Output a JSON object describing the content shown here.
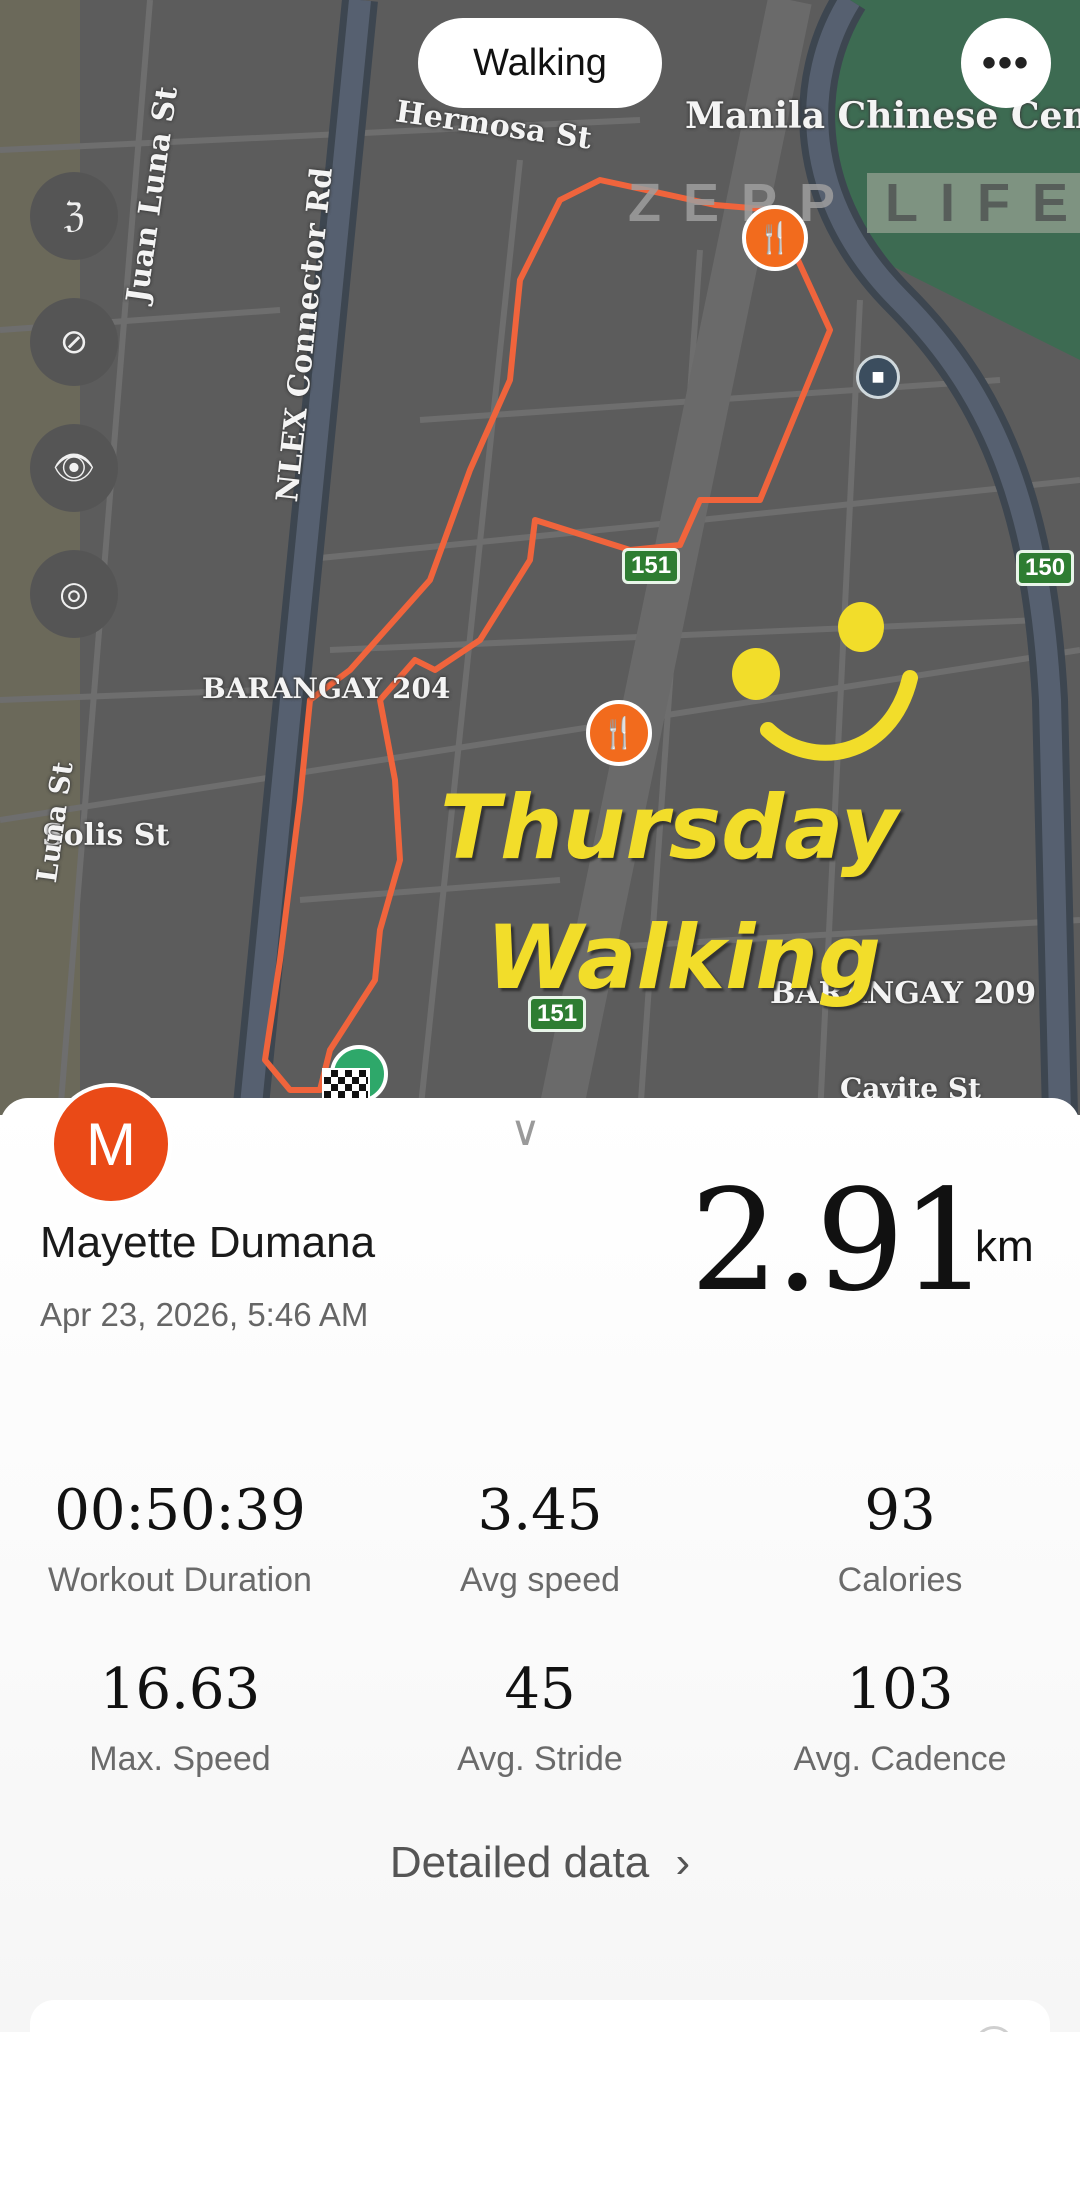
{
  "map": {
    "activity_label": "Walking",
    "more_icon": "more-dots-icon",
    "watermark_left": "ZEPP",
    "watermark_right": "LIFE",
    "streets": [
      "Juan Luna St",
      "NLEX Connector Rd",
      "Hermosa St",
      "Manila Chinese Cem",
      "BARANGAY 204",
      "Solis St",
      "BARANGAY 209",
      "Cavite St",
      "Luna St"
    ],
    "route_shields": [
      "151",
      "151",
      "150"
    ],
    "overlay_line1": "Thursday",
    "overlay_line2": "Walking",
    "controls": [
      "km-unit-icon",
      "no-network-icon",
      "eye-icon",
      "locate-icon"
    ],
    "colors": {
      "route": "#f0643c",
      "pin": "#f26b1d",
      "overlay": "#f2dd2a",
      "cemetery": "#3d6b52"
    }
  },
  "sheet": {
    "avatar_letter": "M",
    "name": "Mayette Dumana",
    "datetime": "Apr 23, 2026, 5:46 AM",
    "distance": "2.91",
    "distance_unit": "km",
    "stats": [
      {
        "value": "00:50:39",
        "label": "Workout Duration"
      },
      {
        "value": "3.45",
        "label": "Avg speed"
      },
      {
        "value": "93",
        "label": "Calories"
      },
      {
        "value": "16.63",
        "label": "Max. Speed"
      },
      {
        "value": "45",
        "label": "Avg. Stride"
      },
      {
        "value": "103",
        "label": "Avg. Cadence"
      }
    ],
    "detailed_link": "Detailed data",
    "colors": {
      "avatar": "#ea4a17"
    }
  }
}
